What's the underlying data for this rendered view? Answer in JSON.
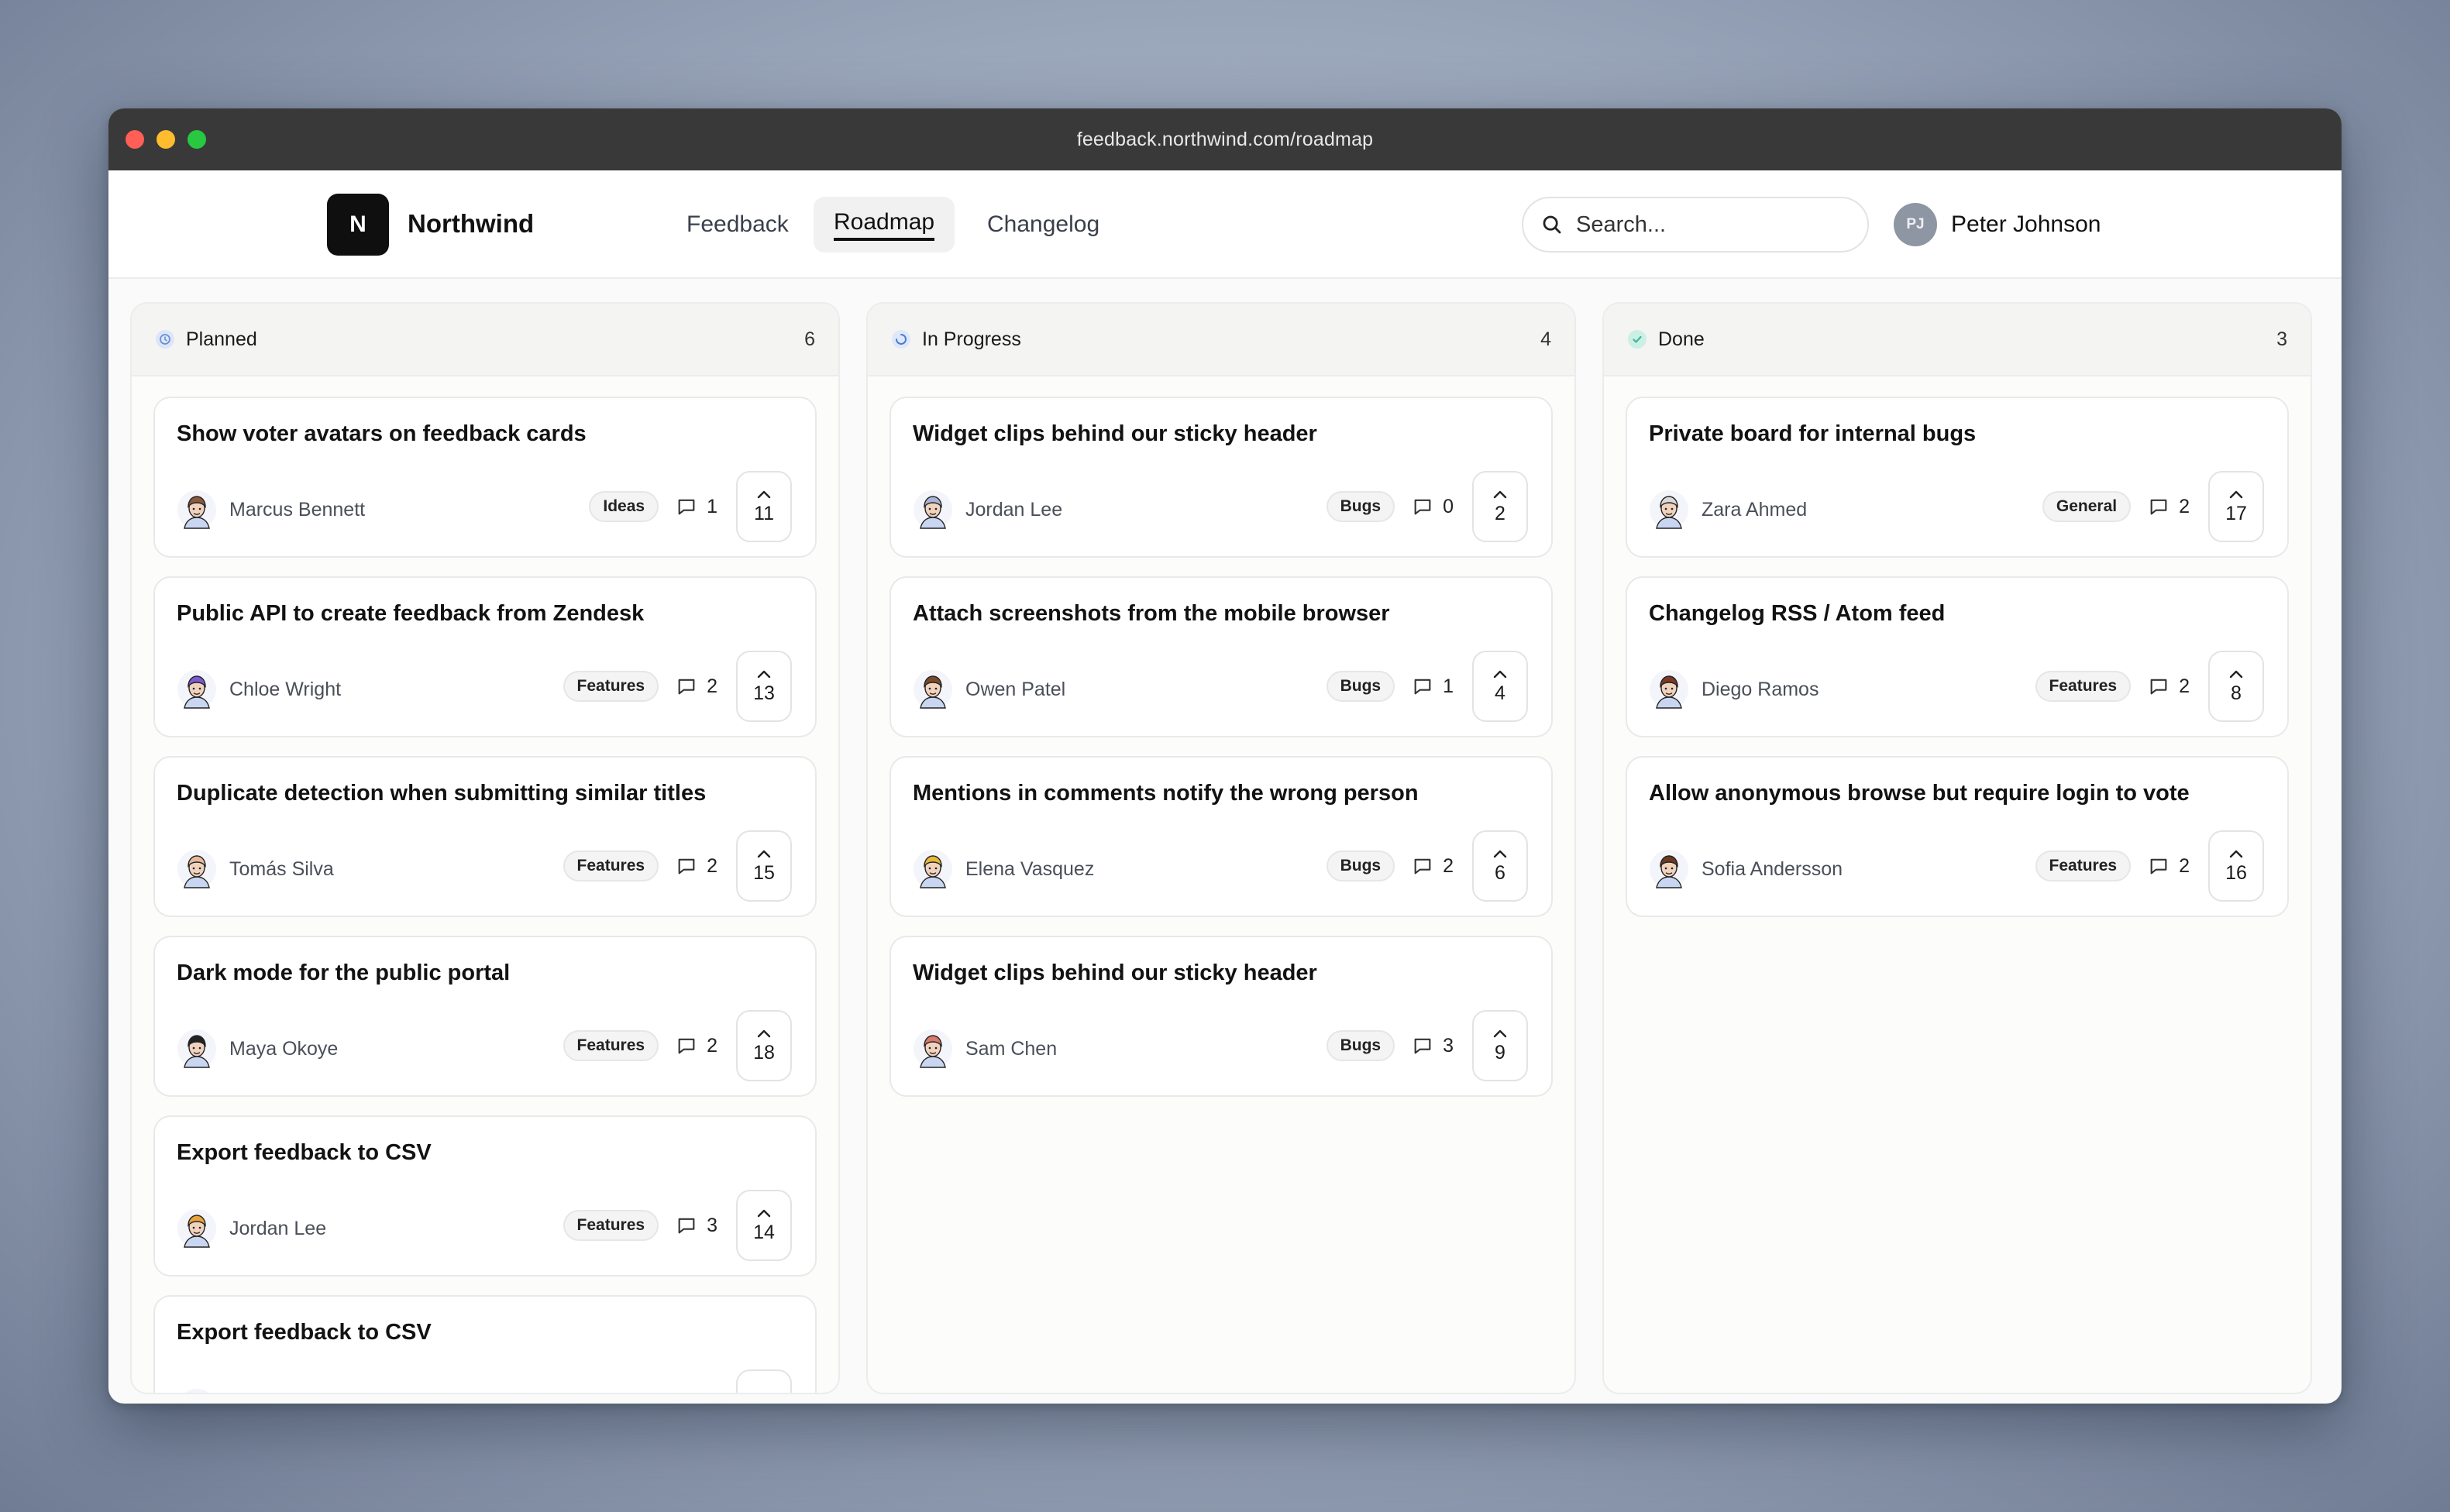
{
  "window": {
    "url": "feedback.northwind.com/roadmap"
  },
  "nav": {
    "logo_letter": "N",
    "brand": "Northwind",
    "tabs": [
      {
        "label": "Feedback",
        "active": false
      },
      {
        "label": "Roadmap",
        "active": true
      },
      {
        "label": "Changelog",
        "active": false
      }
    ],
    "search_placeholder": "Search...",
    "user": {
      "initials": "PJ",
      "name": "Peter Johnson"
    }
  },
  "columns": [
    {
      "title": "Planned",
      "count": "6",
      "status_color": "#6b8fd6",
      "cards": [
        {
          "title": "Show voter avatars on feedback cards",
          "author": "Marcus Bennett",
          "tag": "Ideas",
          "comments": "1",
          "votes": "11",
          "avatar_color": "#8a5a3b"
        },
        {
          "title": "Public API to create feedback from Zendesk",
          "author": "Chloe Wright",
          "tag": "Features",
          "comments": "2",
          "votes": "13",
          "avatar_color": "#7a5bd0"
        },
        {
          "title": "Duplicate detection when submitting similar titles",
          "author": "Tomás Silva",
          "tag": "Features",
          "comments": "2",
          "votes": "15",
          "avatar_color": "#e6b89c"
        },
        {
          "title": "Dark mode for the public portal",
          "author": "Maya Okoye",
          "tag": "Features",
          "comments": "2",
          "votes": "18",
          "avatar_color": "#222222"
        },
        {
          "title": "Export feedback to CSV",
          "author": "Jordan Lee",
          "tag": "Features",
          "comments": "3",
          "votes": "14",
          "avatar_color": "#e8a33a"
        },
        {
          "title": "Export feedback to CSV",
          "author": "",
          "tag": "",
          "comments": "",
          "votes": "",
          "avatar_color": "#cccccc"
        }
      ]
    },
    {
      "title": "In Progress",
      "count": "4",
      "status_color": "#4b7bd8",
      "cards": [
        {
          "title": "Widget clips behind our sticky header",
          "author": "Jordan Lee",
          "tag": "Bugs",
          "comments": "0",
          "votes": "2",
          "avatar_color": "#a9b6d9"
        },
        {
          "title": "Attach screenshots from the mobile browser",
          "author": "Owen Patel",
          "tag": "Bugs",
          "comments": "1",
          "votes": "4",
          "avatar_color": "#7a4a2a"
        },
        {
          "title": "Mentions in comments notify the wrong person",
          "author": "Elena Vasquez",
          "tag": "Bugs",
          "comments": "2",
          "votes": "6",
          "avatar_color": "#e8b83a"
        },
        {
          "title": "Widget clips behind our sticky header",
          "author": "Sam Chen",
          "tag": "Bugs",
          "comments": "3",
          "votes": "9",
          "avatar_color": "#d97a6a"
        }
      ]
    },
    {
      "title": "Done",
      "count": "3",
      "status_color": "#3cb89a",
      "cards": [
        {
          "title": "Private board for internal bugs",
          "author": "Zara Ahmed",
          "tag": "General",
          "comments": "2",
          "votes": "17",
          "avatar_color": "#d9d9d9"
        },
        {
          "title": "Changelog RSS / Atom feed",
          "author": "Diego Ramos",
          "tag": "Features",
          "comments": "2",
          "votes": "8",
          "avatar_color": "#7a3a24"
        },
        {
          "title": "Allow anonymous browse but require login to vote",
          "author": "Sofia Andersson",
          "tag": "Features",
          "comments": "2",
          "votes": "16",
          "avatar_color": "#6b3a22"
        }
      ]
    }
  ]
}
